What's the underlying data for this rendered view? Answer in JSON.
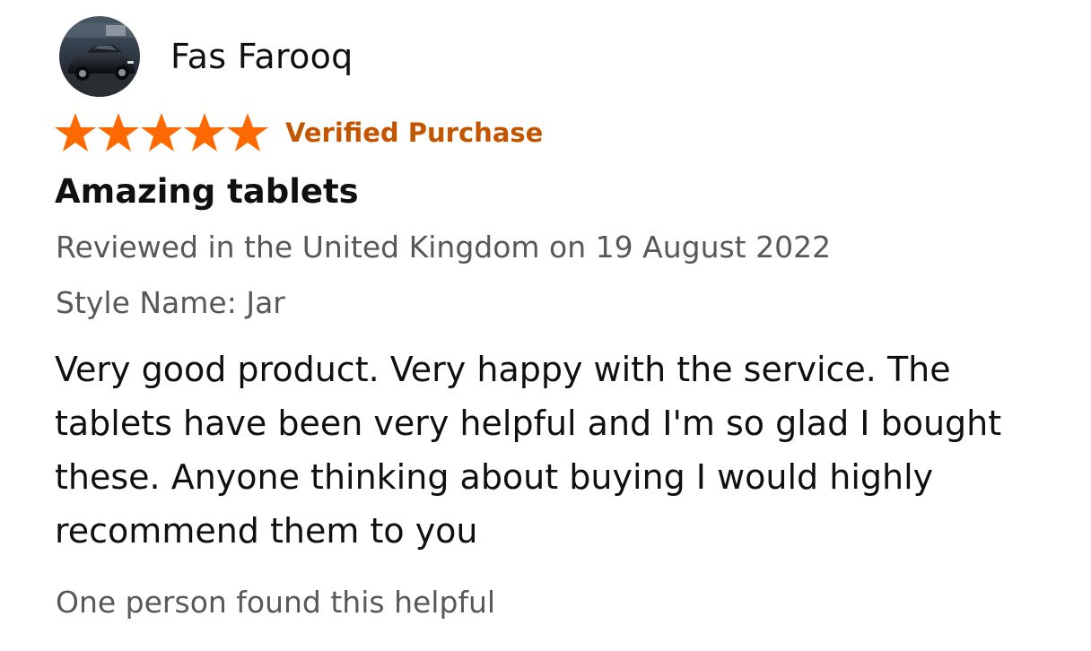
{
  "reviewer": {
    "name": "Fas Farooq",
    "avatar": "avatar-photo-black-car"
  },
  "rating": {
    "stars": 5,
    "max_stars": 5,
    "star_color": "#ff6a00",
    "verified_label": "Verified Purchase",
    "verified_color": "#c45500"
  },
  "review": {
    "title": "Amazing tablets",
    "date_line": "Reviewed in the United Kingdom on 19 August 2022",
    "style_line": "Style Name: Jar",
    "body": "Very good product. Very happy with the service. The tablets have been very helpful and I'm so glad I bought these. Anyone thinking about buying I would highly recommend them to you",
    "helpful_text": "One person found this helpful"
  },
  "colors": {
    "text_primary": "#0f1111",
    "text_secondary": "#565959"
  }
}
